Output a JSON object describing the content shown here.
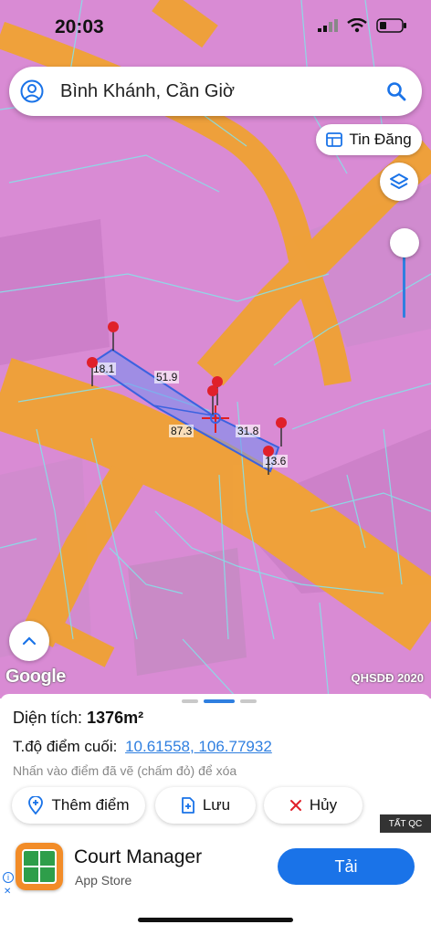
{
  "status": {
    "time": "20:03"
  },
  "search": {
    "query": "Bình Khánh, Cần Giờ"
  },
  "tin_dang_label": "Tin Đăng",
  "map": {
    "attribution": "Google",
    "layer_label": "QHSDĐ 2020",
    "parcel_labels": [
      "18.1",
      "51.9",
      "87.3",
      "31.8",
      "13.6"
    ],
    "zoning_color": "#d87ad8",
    "road_color": "#f0a030",
    "parcel_fill": "#6f8ff0"
  },
  "panel": {
    "area_label": "Diện tích:",
    "area_value": "1376m²",
    "coords_label": "T.độ điểm cuối:",
    "coords_value": "10.61558, 106.77932",
    "hint": "Nhấn vào điểm đã vẽ (chấm đỏ) để xóa",
    "add_label": "Thêm điểm",
    "save_label": "Lưu",
    "delete_label": "Hủy"
  },
  "ad": {
    "tag": "TẤT QC",
    "title": "Court Manager",
    "subtitle": "App Store",
    "install_label": "Tải"
  }
}
